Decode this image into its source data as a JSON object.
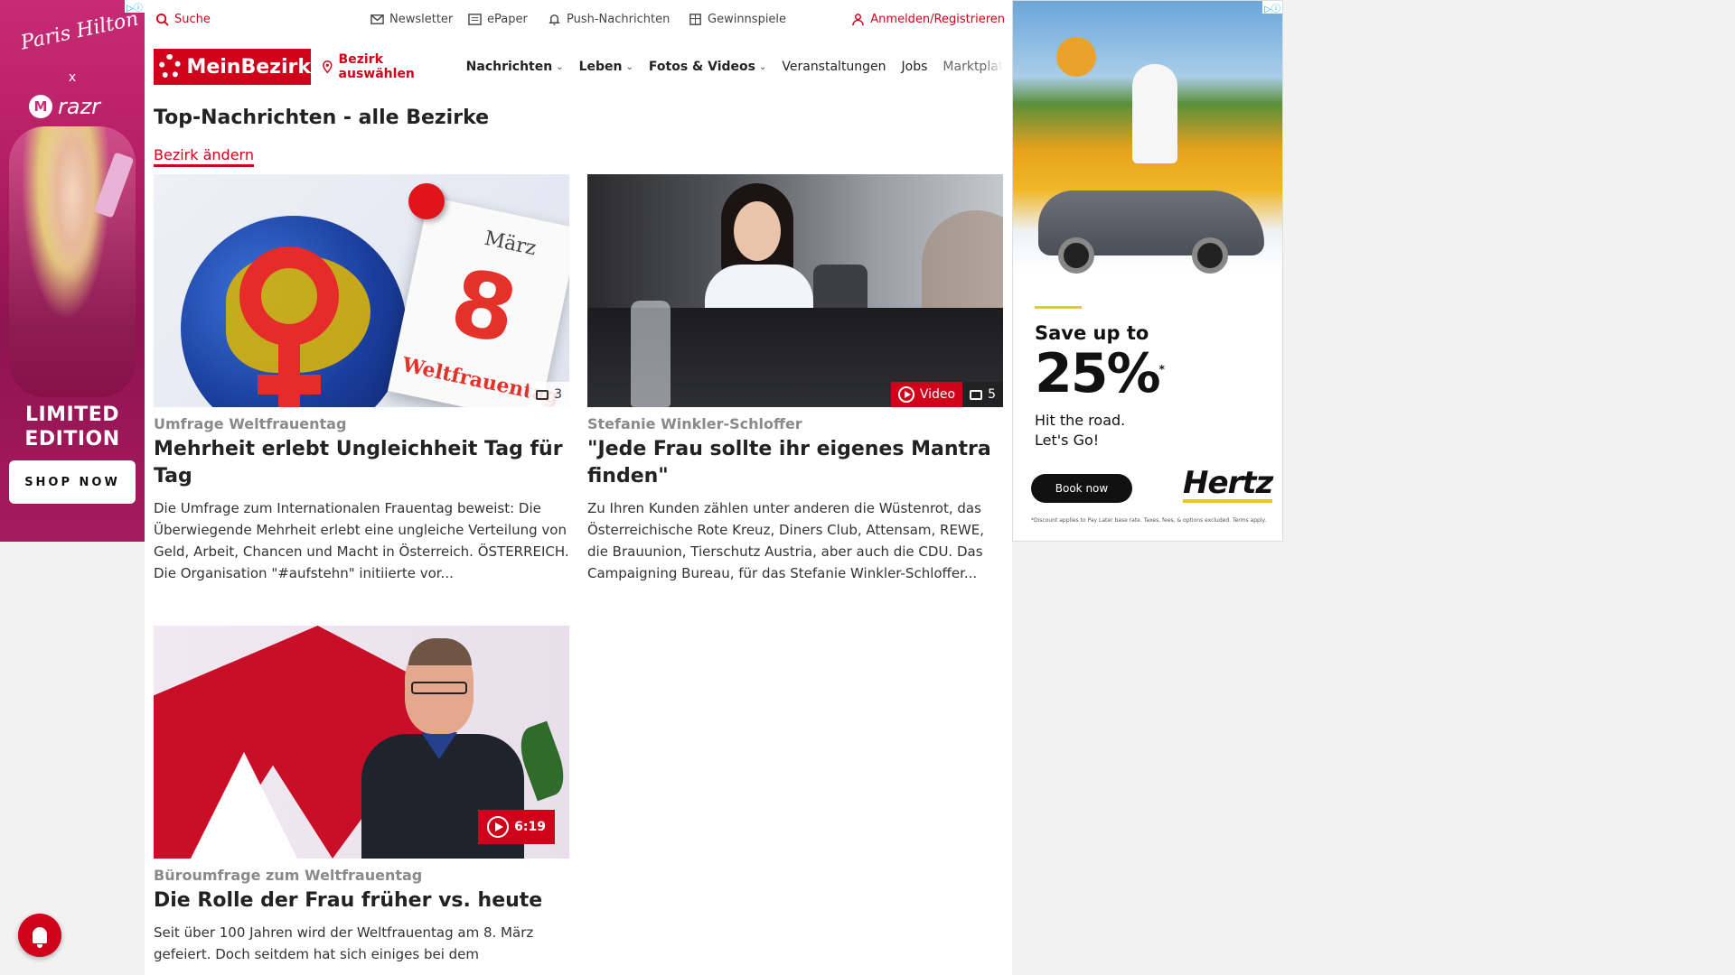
{
  "ads": {
    "left": {
      "signature": "Paris Hilton",
      "times": "x",
      "brand": "razr",
      "brand_logo": "M",
      "limited_line1": "LIMITED",
      "limited_line2": "EDITION",
      "cta": "SHOP NOW"
    },
    "right": {
      "save": "Save up to",
      "percent": "25%",
      "percent_mark": "*",
      "tagline1": "Hit the road.",
      "tagline2": "Let's Go!",
      "cta": "Book now",
      "brand": "Hertz",
      "fine_print": "*Discount applies to Pay Later base rate. Taxes, fees, & options excluded. Terms apply."
    }
  },
  "util": {
    "search": "Suche",
    "newsletter": "Newsletter",
    "epaper": "ePaper",
    "push": "Push-Nachrichten",
    "gewinnspiele": "Gewinnspiele",
    "login": "Anmelden/Registrieren"
  },
  "nav": {
    "logo": "MeinBezirk",
    "bezirk": "Bezirk auswählen",
    "items": [
      "Nachrichten",
      "Leben",
      "Fotos & Videos",
      "Veranstaltungen",
      "Jobs",
      "Marktplatz"
    ]
  },
  "page": {
    "title": "Top-Nachrichten - alle Bezirke",
    "change_link": "Bezirk ändern"
  },
  "articles": [
    {
      "image_text": {
        "month": "März",
        "day": "8",
        "label": "Weltfrauentag"
      },
      "photo_count": "3",
      "kicker": "Umfrage Weltfrauentag",
      "headline": "Mehrheit erlebt Ungleichheit Tag für Tag",
      "teaser": "Die Umfrage zum Internationalen Frauentag beweist: Die Überwiegende Mehrheit erlebt eine ungleiche Verteilung von Geld, Arbeit, Chancen und Macht in Österreich. ÖSTERREICH. Die Organisation \"#aufstehn\" initiierte vor..."
    },
    {
      "video_label": "Video",
      "photo_count": "5",
      "kicker": "Stefanie Winkler-Schloffer",
      "headline": "\"Jede Frau sollte ihr eigenes Mantra finden\"",
      "teaser": "Zu Ihren Kunden zählen unter anderen die Wüstenrot, das Österreichische Rote Kreuz, Diners Club, Attensam, REWE, die Brauunion, Tierschutz Austria, aber auch die CDU. Das Campaigning Bureau, für das Stefanie Winkler-Schloffer..."
    },
    {
      "duration": "6:19",
      "kicker": "Büroumfrage zum Weltfrauentag",
      "headline": "Die Rolle der Frau früher vs. heute",
      "teaser": "Seit über 100 Jahren wird der Weltfrauentag am 8. März gefeiert. Doch seitdem hat sich einiges bei dem"
    }
  ],
  "colors": {
    "accent": "#d0021b",
    "hertz_yellow": "#f5c518"
  },
  "icons": [
    "search-icon",
    "mail-icon",
    "newspaper-icon",
    "bell-icon",
    "gift-icon",
    "user-icon",
    "map-pin-icon",
    "chevron-down-icon",
    "photo-stack-icon",
    "play-icon",
    "adchoices-icon"
  ]
}
